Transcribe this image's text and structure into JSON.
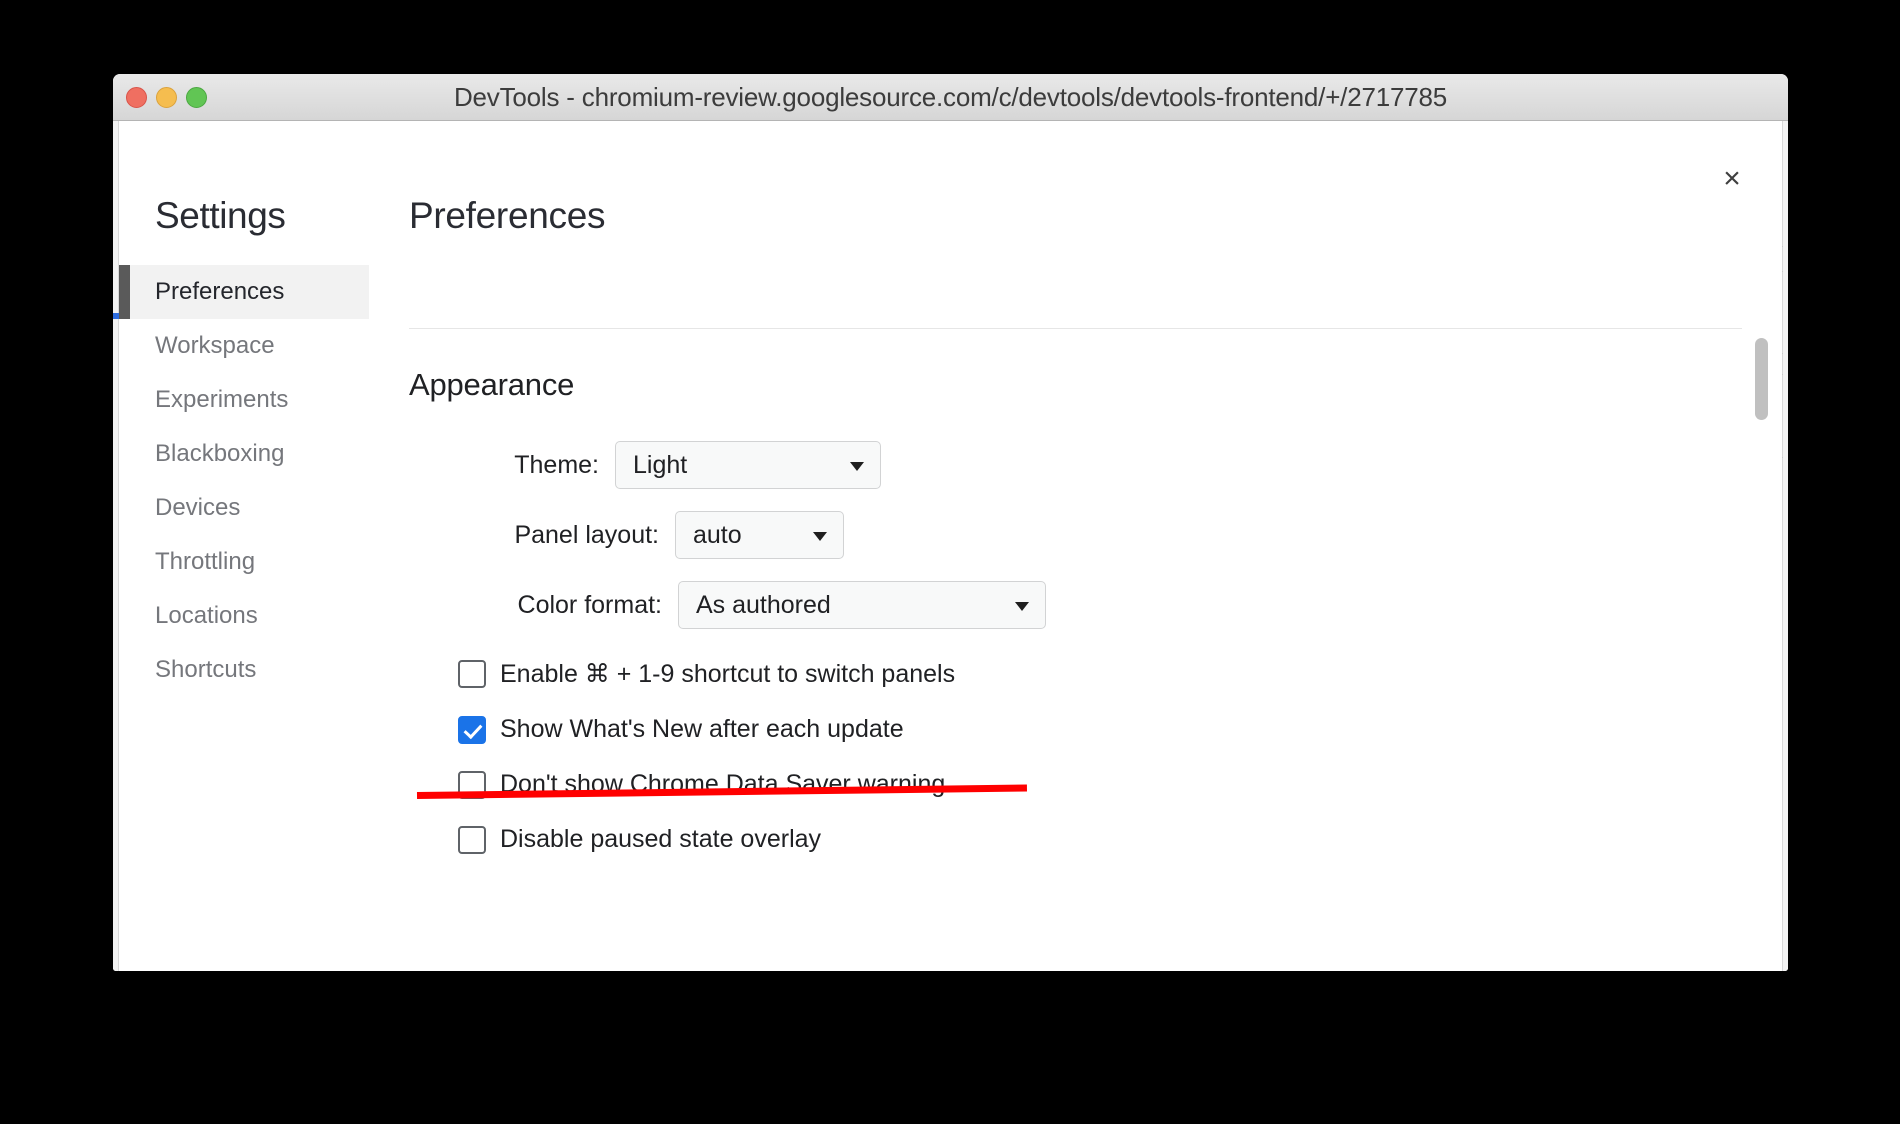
{
  "window": {
    "title": "DevTools - chromium-review.googlesource.com/c/devtools/devtools-frontend/+/2717785",
    "traffic_lights": {
      "close_label": "close",
      "minimize_label": "minimize",
      "maximize_label": "maximize"
    }
  },
  "dialog": {
    "close_glyph": "×",
    "heading": "Settings",
    "panel_title": "Preferences"
  },
  "sidebar": {
    "items": [
      {
        "label": "Preferences",
        "selected": true
      },
      {
        "label": "Workspace",
        "selected": false
      },
      {
        "label": "Experiments",
        "selected": false
      },
      {
        "label": "Blackboxing",
        "selected": false
      },
      {
        "label": "Devices",
        "selected": false
      },
      {
        "label": "Throttling",
        "selected": false
      },
      {
        "label": "Locations",
        "selected": false
      },
      {
        "label": "Shortcuts",
        "selected": false
      }
    ]
  },
  "appearance": {
    "section_title": "Appearance",
    "fields": [
      {
        "label": "Theme:",
        "value": "Light"
      },
      {
        "label": "Panel layout:",
        "value": "auto"
      },
      {
        "label": "Color format:",
        "value": "As authored"
      }
    ],
    "checkboxes": [
      {
        "label": "Enable ⌘ + 1-9 shortcut to switch panels",
        "checked": false,
        "struck": false
      },
      {
        "label": "Show What's New after each update",
        "checked": true,
        "struck": false
      },
      {
        "label": "Don't show Chrome Data Saver warning",
        "checked": false,
        "struck": true
      },
      {
        "label": "Disable paused state overlay",
        "checked": false,
        "struck": false
      }
    ]
  },
  "annotation": {
    "strikethrough_color": "#ff0000",
    "target_label": "Don't show Chrome Data Saver warning"
  },
  "colors": {
    "accent_checkbox": "#1a73e8",
    "selected_sidebar_bar": "#5a5a5a",
    "selected_sidebar_bg": "#f2f2f2",
    "titlebar_text": "#3c3c3c"
  }
}
